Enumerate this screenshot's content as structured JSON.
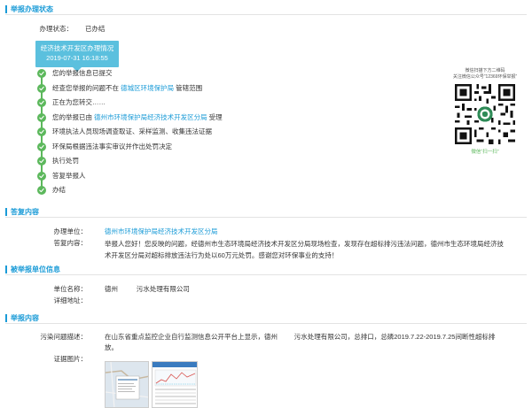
{
  "report_status_section": {
    "title": "举报办理状态",
    "status_label": "办理状态：",
    "status_value": "已办结",
    "status_box": {
      "line1": "经济技术开发区办理情况",
      "line2": "2019-07-31 16:18:55"
    },
    "timeline": [
      {
        "prefix": "您的举报信息已提交",
        "highlight": "",
        "suffix": ""
      },
      {
        "prefix": "经查您举报的问题不在 ",
        "highlight": "德城区环境保护局",
        "suffix": " 管辖范围"
      },
      {
        "prefix": "正在为您转交……",
        "highlight": "",
        "suffix": ""
      },
      {
        "prefix": "您的举报已由 ",
        "highlight": "德州市环境保护局经济技术开发区分局",
        "suffix": " 受理"
      },
      {
        "prefix": "环境执法人员现场调查取证、采样监测、收集违法证据",
        "highlight": "",
        "suffix": ""
      },
      {
        "prefix": "环保局根据违法事实审议并作出处罚决定",
        "highlight": "",
        "suffix": ""
      },
      {
        "prefix": "执行处罚",
        "highlight": "",
        "suffix": ""
      },
      {
        "prefix": "答复举报人",
        "highlight": "",
        "suffix": ""
      },
      {
        "prefix": "办结",
        "highlight": "",
        "suffix": ""
      }
    ],
    "qr": {
      "caption_line1": "微信扫描下方二维码",
      "caption_line2": "关注微信公众号“12369环保举报”",
      "bottom_text": "微信“扫一扫”"
    }
  },
  "reply_section": {
    "title": "答复内容",
    "unit_label": "办理单位：",
    "unit_value": "德州市环境保护局经济技术开发区分局",
    "content_label": "答复内容：",
    "content_line1": "举报人您好！您反映的问题，经德州市生态环境局经济技术开发区分局现场检查，发现存在超标排污违法问题，德州市生态环境局经济技",
    "content_line2": "术开发区分局对超标排放违法行为处以60万元处罚。感谢您对环保事业的支持！"
  },
  "reported_unit_section": {
    "title": "被举报单位信息",
    "name_label": "单位名称：",
    "name_value": "德州          污水处理有限公司",
    "address_label": "详细地址："
  },
  "report_content_section": {
    "title": "举报内容",
    "problem_label": "污染问题描述：",
    "problem_line1": "在山东省重点监控企业自行监测信息公开平台上显示，德州         污水处理有限公司，总排口，总磷2019.7.22-2019.7.25间断性超标排",
    "problem_line2": "放。",
    "evidence_label": "证据图片："
  },
  "colors": {
    "accent_blue": "#1a9bd7",
    "status_box": "#5bc0de",
    "timeline_green": "#5cb85c"
  }
}
